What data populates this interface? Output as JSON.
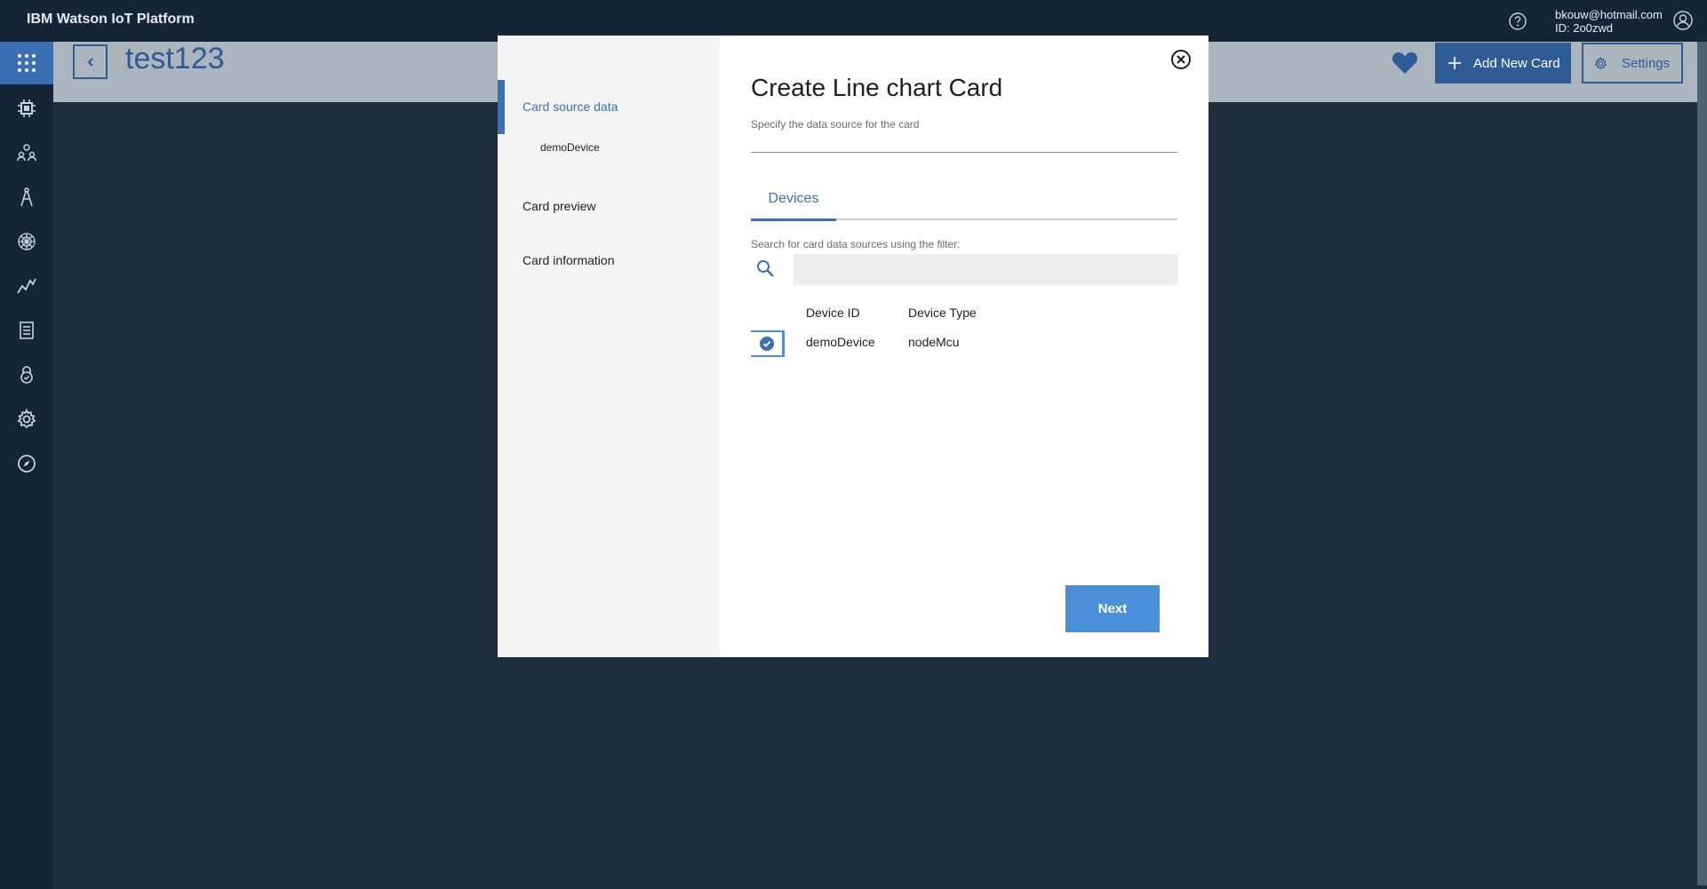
{
  "app": {
    "brand": "IBM Watson IoT Platform",
    "user_email": "bkouw@hotmail.com",
    "user_id": "ID: 2o0zwd"
  },
  "header": {
    "title": "test123",
    "add_card_label": "Add New Card",
    "settings_label": "Settings"
  },
  "sidebar": {
    "items": [
      {
        "icon": "apps-grid-icon",
        "active": true
      },
      {
        "icon": "chip-icon"
      },
      {
        "icon": "members-icon"
      },
      {
        "icon": "compass-tool-icon"
      },
      {
        "icon": "network-icon"
      },
      {
        "icon": "analytics-icon"
      },
      {
        "icon": "logs-icon"
      },
      {
        "icon": "security-icon"
      },
      {
        "icon": "settings-gear-icon"
      },
      {
        "icon": "explore-compass-icon"
      }
    ]
  },
  "modal": {
    "title": "Create Line chart Card",
    "subtitle": "Specify the data source for the card",
    "steps": [
      {
        "label": "Card source data",
        "active": true,
        "sub": "demoDevice"
      },
      {
        "label": "Card preview"
      },
      {
        "label": "Card information"
      }
    ],
    "tab": "Devices",
    "filter_label": "Search for card data sources using the filter:",
    "search_placeholder": "",
    "table": {
      "columns": [
        "Device ID",
        "Device Type"
      ],
      "rows": [
        {
          "device_id": "demoDevice",
          "device_type": "nodeMcu",
          "selected": true
        }
      ]
    },
    "next_label": "Next"
  },
  "colors": {
    "accent": "#3d70b2",
    "primary_button": "#4a90d9",
    "topbar": "#152535",
    "background": "#1e2d3c"
  }
}
